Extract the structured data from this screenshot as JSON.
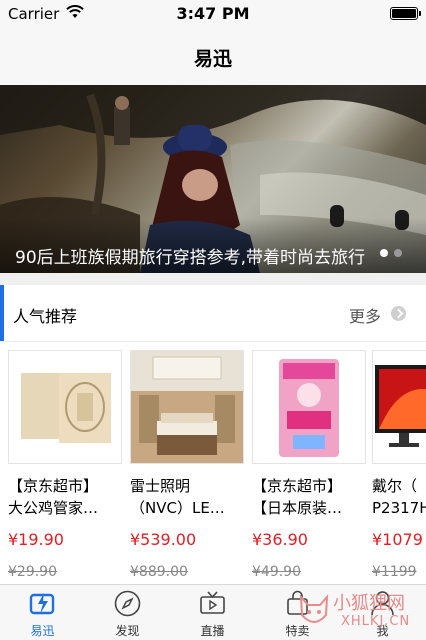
{
  "status_bar": {
    "carrier": "Carrier",
    "time": "3:47 PM"
  },
  "nav": {
    "title": "易迅"
  },
  "banner": {
    "caption": "90后上班族假期旅行穿搭参考,带着时尚去旅行"
  },
  "section": {
    "title": "人气推荐",
    "more_label": "更多"
  },
  "products": [
    {
      "name": "【京东超市】\n大公鸡管家…",
      "price": "¥19.90",
      "original_price": "¥29.90"
    },
    {
      "name": "雷士照明\n（NVC）LE…",
      "price": "¥539.00",
      "original_price": "¥889.00"
    },
    {
      "name": "【京东超市】\n【日本原装…",
      "price": "¥36.90",
      "original_price": "¥49.90"
    },
    {
      "name": "戴尔（\nP2317H",
      "price": "¥1079",
      "original_price": "¥1199"
    }
  ],
  "tabs": [
    {
      "label": "易迅",
      "icon": "home-icon",
      "active": true
    },
    {
      "label": "发现",
      "icon": "compass-icon",
      "active": false
    },
    {
      "label": "直播",
      "icon": "tv-icon",
      "active": false
    },
    {
      "label": "特卖",
      "icon": "bag-icon",
      "active": false
    },
    {
      "label": "我",
      "icon": "person-icon",
      "active": false
    }
  ],
  "watermark": {
    "text": "小狐狸网",
    "sub": "XHLKJ.CN"
  },
  "colors": {
    "accent": "#1f6fe0",
    "price": "#e31e24"
  }
}
